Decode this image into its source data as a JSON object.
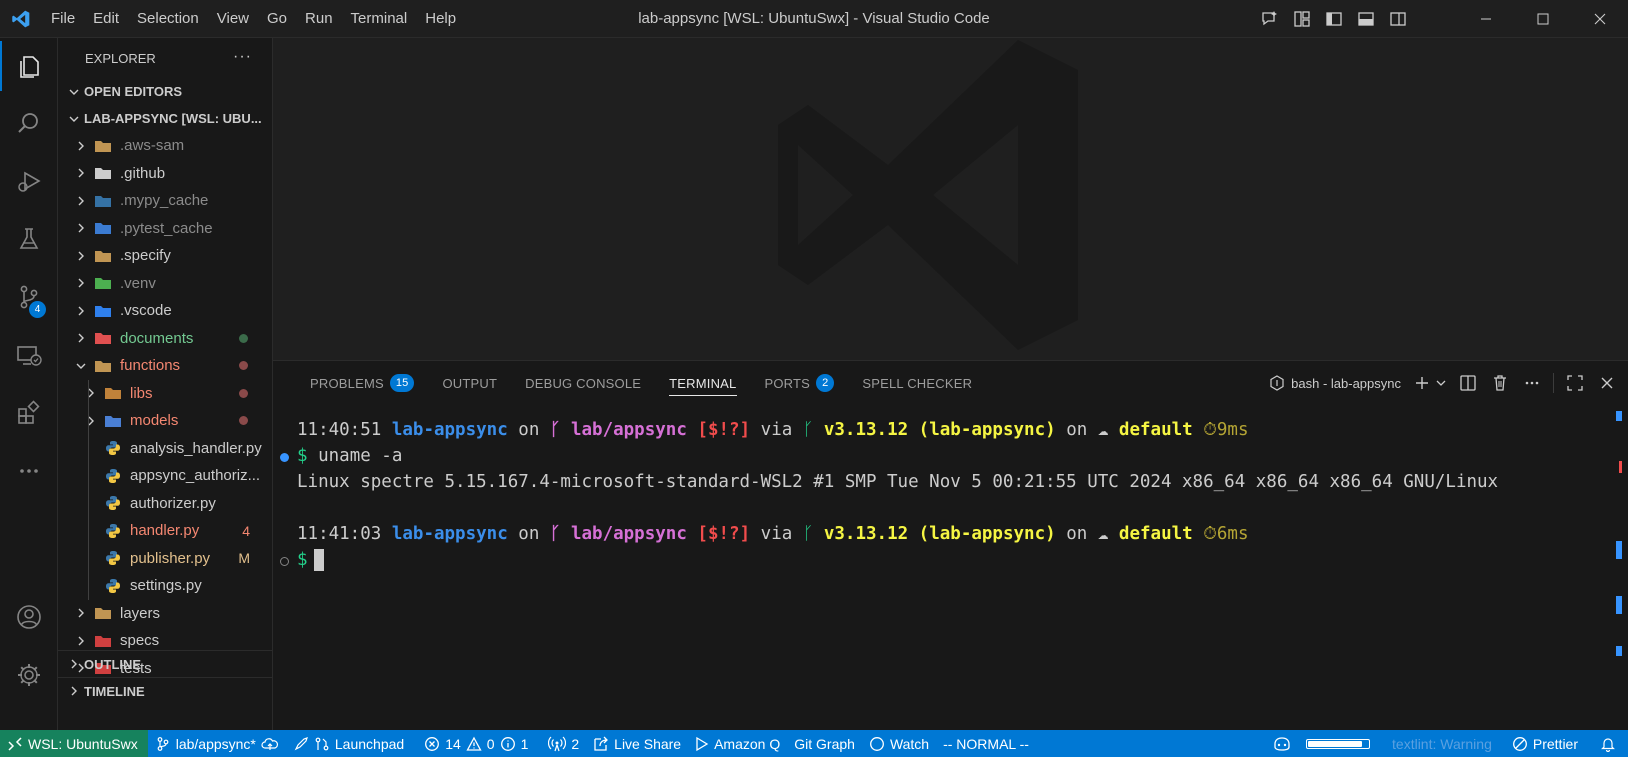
{
  "window": {
    "title": "lab-appsync [WSL: UbuntuSwx] - Visual Studio Code",
    "menu": [
      "File",
      "Edit",
      "Selection",
      "View",
      "Go",
      "Run",
      "Terminal",
      "Help"
    ]
  },
  "activity_bar": {
    "items": [
      "explorer",
      "search",
      "run-and-debug",
      "testing",
      "source-control",
      "remote-explorer",
      "extensions",
      "more"
    ],
    "source_control_badge": "4"
  },
  "sidebar": {
    "header": "EXPLORER",
    "more": "···",
    "open_editors": "OPEN EDITORS",
    "workspace": "LAB-APPSYNC [WSL: UBU...",
    "tree": [
      {
        "label": ".aws-sam",
        "type": "folder",
        "color": "gray"
      },
      {
        "label": ".github",
        "type": "folder-github",
        "color": "white"
      },
      {
        "label": ".mypy_cache",
        "type": "folder-python",
        "color": "gray"
      },
      {
        "label": ".pytest_cache",
        "type": "folder-test",
        "color": "gray"
      },
      {
        "label": ".specify",
        "type": "folder",
        "color": "white"
      },
      {
        "label": ".venv",
        "type": "folder-venv",
        "color": "gray"
      },
      {
        "label": ".vscode",
        "type": "folder-vscode",
        "color": "white"
      },
      {
        "label": "documents",
        "type": "folder-docs",
        "color": "green"
      },
      {
        "label": "functions",
        "type": "folder-open",
        "color": "red"
      },
      {
        "label": "libs",
        "type": "folder-lib",
        "color": "red"
      },
      {
        "label": "models",
        "type": "folder-models",
        "color": "red"
      },
      {
        "label": "analysis_handler.py",
        "type": "python",
        "color": "white"
      },
      {
        "label": "appsync_authoriz...",
        "type": "python",
        "color": "white"
      },
      {
        "label": "authorizer.py",
        "type": "python",
        "color": "white"
      },
      {
        "label": "handler.py",
        "type": "python",
        "color": "red",
        "deco": "4"
      },
      {
        "label": "publisher.py",
        "type": "python",
        "color": "mod",
        "deco": "M"
      },
      {
        "label": "settings.py",
        "type": "python",
        "color": "white"
      },
      {
        "label": "layers",
        "type": "folder",
        "color": "white"
      },
      {
        "label": "specs",
        "type": "folder-specs",
        "color": "white"
      },
      {
        "label": "tests",
        "type": "folder-tests",
        "color": "white"
      }
    ],
    "outline": "OUTLINE",
    "timeline": "TIMELINE"
  },
  "panel": {
    "tabs": [
      {
        "label": "PROBLEMS",
        "badge": "15"
      },
      {
        "label": "OUTPUT"
      },
      {
        "label": "DEBUG CONSOLE"
      },
      {
        "label": "TERMINAL",
        "active": true
      },
      {
        "label": "PORTS",
        "badge": "2"
      },
      {
        "label": "SPELL CHECKER"
      }
    ],
    "terminal_name": "bash - lab-appsync"
  },
  "terminal": {
    "prompt1": {
      "time": "11:40:51",
      "dir": "lab-appsync",
      "on": "on",
      "branch_icon": "ᚴ",
      "branch": "lab/appsync",
      "status": "[$!?]",
      "via": "via",
      "py_version": "v3.13.12 (lab-appsync)",
      "on2": "on",
      "cloud_icon": "☁",
      "aws": "default",
      "timer_icon": "⏱",
      "duration": "9ms"
    },
    "command1": {
      "prompt": "$",
      "cmd": "uname -a"
    },
    "output1": "Linux spectre 5.15.167.4-microsoft-standard-WSL2 #1 SMP Tue Nov 5 00:21:55 UTC 2024 x86_64 x86_64 x86_64 GNU/Linux",
    "prompt2": {
      "time": "11:41:03",
      "dir": "lab-appsync",
      "on": "on",
      "branch_icon": "ᚴ",
      "branch": "lab/appsync",
      "status": "[$!?]",
      "via": "via",
      "py_version": "v3.13.12 (lab-appsync)",
      "on2": "on",
      "cloud_icon": "☁",
      "aws": "default",
      "timer_icon": "⏱",
      "duration": "6ms"
    },
    "command2": {
      "prompt": "$"
    }
  },
  "statusbar": {
    "remote": "WSL: UbuntuSwx",
    "branch": "lab/appsync*",
    "launchpad": "Launchpad",
    "errors": "14",
    "warnings": "0",
    "info": "1",
    "ports": "2",
    "live_share": "Live Share",
    "amazon_q": "Amazon Q",
    "git_graph": "Git Graph",
    "watch": "Watch",
    "vim_mode": "-- NORMAL --",
    "textlint": "textlint: Warning",
    "prettier": "Prettier",
    "progress": 0.9
  },
  "colors": {
    "accent": "#0078d4",
    "remote": "#16825d",
    "background": "#1f1f1f"
  }
}
